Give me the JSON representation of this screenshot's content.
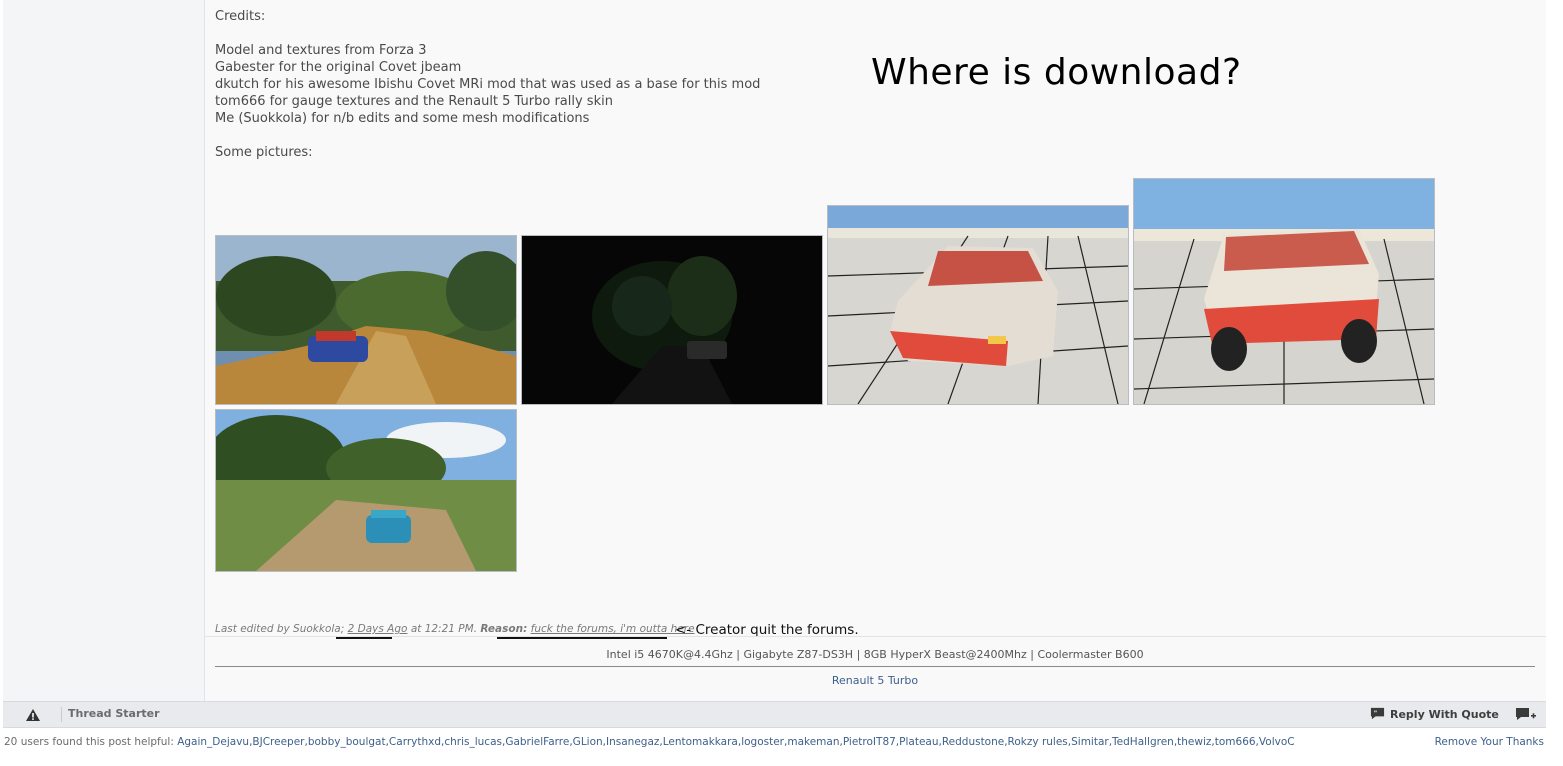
{
  "post": {
    "credits_lines": [
      "Credits:",
      "",
      "Model and textures from Forza 3",
      "Gabester for the original Covet jbeam",
      "dkutch for his awesome Ibishu Covet MRi mod that was used as a base for this mod",
      "tom666 for gauge textures and the Renault 5 Turbo rally skin",
      "Me (Suokkola) for n/b edits and some mesh modifications",
      "",
      "Some pictures:"
    ],
    "meme_caption": "Where is download?",
    "edit_note": {
      "prefix": "Last edited by Suokkola;",
      "date": "2 Days Ago",
      "at": "at 12:21 PM.",
      "reason_label": "Reason:",
      "reason_text": "fuck the forums, i'm outta here"
    },
    "annotation": "<- Creator quit the forums."
  },
  "signature": {
    "specs": "Intel i5 4670K@4.4Ghz | Gigabyte Z87-DS3H | 8GB HyperX Beast@2400Mhz | Coolermaster B600",
    "link": "Renault 5 Turbo"
  },
  "footer": {
    "thread_starter": "Thread Starter",
    "reply_with_quote": "Reply With Quote"
  },
  "thanks": {
    "label": "20 users found this post helpful:",
    "users": "Again_Dejavu,BJCreeper,bobby_boulgat,Carrythxd,chris_lucas,GabrielFarre,GLion,Insanegaz,Lentomakkara,logoster,makeman,PietroIT87,Plateau,Reddustone,Rokzy rules,Simitar,TedHallgren,thewiz,tom666,VolvoC",
    "remove": "Remove Your Thanks"
  },
  "icons": [
    "warning-triangle-icon",
    "reply-quote-icon",
    "multi-quote-icon"
  ],
  "colors": {
    "link": "#3e5f8a",
    "footer_bar": "#e9eaed"
  }
}
